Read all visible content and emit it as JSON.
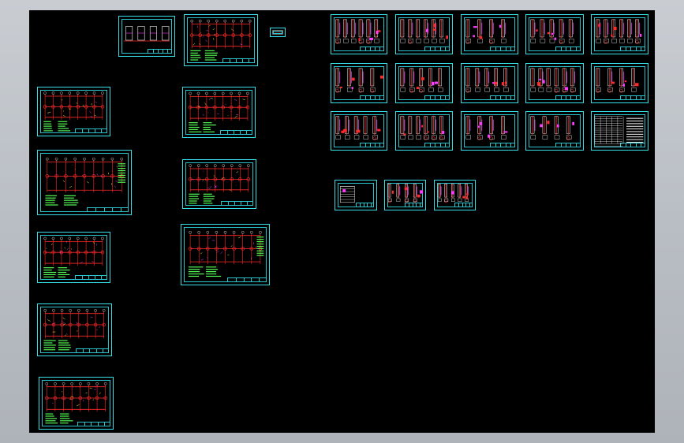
{
  "viewport": {
    "name": "cad-model-space",
    "background": "#000000",
    "frame_color": "#35e0e8",
    "stroke_red": "#ff2a2a",
    "stroke_magenta": "#ff3cff",
    "stroke_yellow": "#ffff33",
    "stroke_green": "#55ff55",
    "stroke_white": "#ffffff"
  },
  "sheet_groups": {
    "left_column": "drawing-sheet",
    "middle_column": "drawing-sheet",
    "detail_grid": "detail-sheet",
    "small_sheets": "small-sheet"
  }
}
